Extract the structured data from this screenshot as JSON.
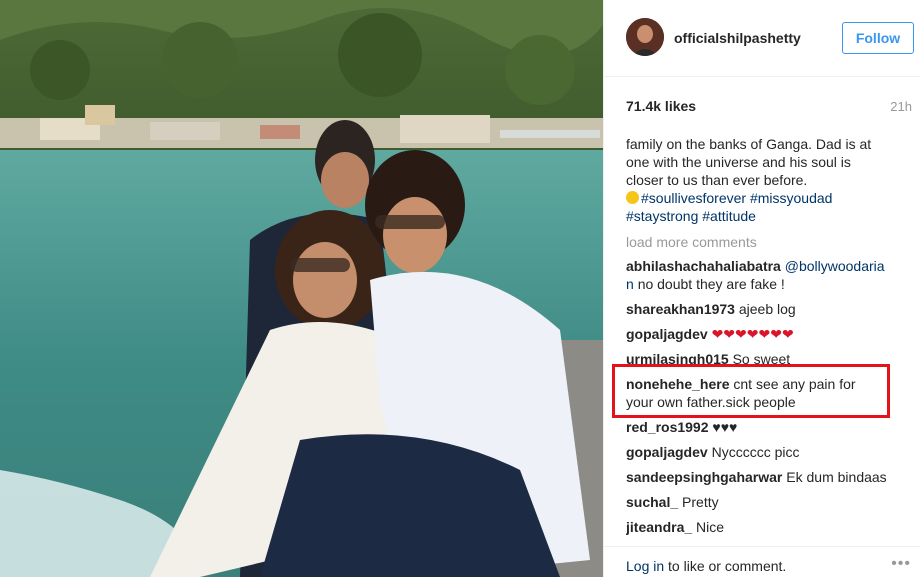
{
  "post": {
    "username": "officialshilpashetty",
    "follow_label": "Follow",
    "likes": "71.4k likes",
    "time": "21h",
    "caption_lines": [
      "family on the banks of Ganga. Dad is at",
      "one with the universe and his soul is",
      "closer to us than ever before."
    ],
    "hashtags_line1": "#soullivesforever #missyoudad",
    "hashtags_line2": "#staystrong #attitude",
    "load_more": "load more comments"
  },
  "comments": [
    {
      "user": "abhilashachahaliabatra",
      "mention": "@bollywoodaria",
      "mention_cont": "n",
      "text": "no doubt they are fake !"
    },
    {
      "user": "shareakhan1973",
      "text": "ajeeb log"
    },
    {
      "user": "gopaljagdev",
      "hearts": "❤❤❤❤❤❤❤"
    },
    {
      "user": "urmilasingh015",
      "text": "So sweet"
    },
    {
      "user": "nonehehe_here",
      "text": "cnt see any pain for",
      "text2": "your own father.sick people"
    },
    {
      "user": "red_ros1992",
      "text": "♥♥♥"
    },
    {
      "user": "gopaljagdev",
      "text": "Nycccccc picc"
    },
    {
      "user": "sandeepsinghgaharwar",
      "text": "Ek dum bindaas"
    },
    {
      "user": "suchal_",
      "text": "Pretty"
    },
    {
      "user": "jiteandra_",
      "text": "Nice"
    }
  ],
  "footer": {
    "login_link": "Log in",
    "login_rest": " to like or comment.",
    "more_icon": "ellipsis-icon"
  },
  "colors": {
    "follow_blue": "#3897f0",
    "link_blue": "#003569",
    "highlight_red": "#e3121b"
  }
}
